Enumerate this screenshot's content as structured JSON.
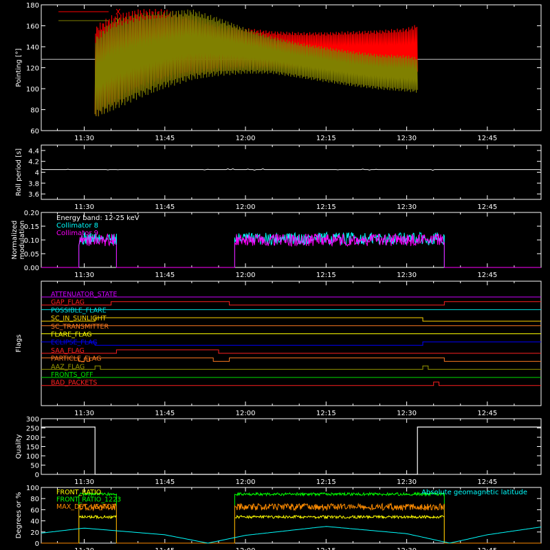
{
  "chart_data": [
    {
      "type": "line",
      "ylabel": "Pointing [°]",
      "ylim": [
        60,
        180
      ],
      "yticks": [
        60,
        80,
        100,
        120,
        140,
        160,
        180
      ],
      "xticks": [
        "11:30",
        "11:45",
        "12:00",
        "12:15",
        "12:30",
        "12:45"
      ],
      "xlim": [
        "11:22",
        "12:55"
      ],
      "legend": [
        "X",
        "Y"
      ],
      "reference_line": 128,
      "series": [
        {
          "name": "X",
          "color": "#ff0000",
          "x": [
            "11:32",
            "11:35",
            "11:40",
            "11:45",
            "11:50",
            "11:55",
            "12:00",
            "12:05",
            "12:10",
            "12:15",
            "12:20",
            "12:25",
            "12:30",
            "12:32"
          ],
          "upper": [
            160,
            170,
            176,
            176,
            170,
            162,
            158,
            155,
            154,
            154,
            155,
            156,
            158,
            162
          ],
          "lower": [
            72,
            80,
            96,
            106,
            112,
            116,
            118,
            118,
            118,
            118,
            118,
            117,
            115,
            112
          ]
        },
        {
          "name": "Y",
          "color": "#808000",
          "x": [
            "11:32",
            "11:35",
            "11:40",
            "11:45",
            "11:50",
            "11:55",
            "12:00",
            "12:05",
            "12:10",
            "12:15",
            "12:20",
            "12:25",
            "12:30",
            "12:32"
          ],
          "upper": [
            150,
            165,
            172,
            174,
            176,
            168,
            158,
            150,
            144,
            140,
            136,
            133,
            132,
            130
          ],
          "lower": [
            72,
            78,
            90,
            100,
            108,
            112,
            114,
            114,
            110,
            106,
            102,
            99,
            97,
            96
          ]
        }
      ]
    },
    {
      "type": "line",
      "ylabel": "Roll period [s]",
      "ylim": [
        3.5,
        4.5
      ],
      "yticks": [
        3.6,
        3.8,
        4.0,
        4.2,
        4.4
      ],
      "xticks": [
        "11:30",
        "11:45",
        "12:00",
        "12:15",
        "12:30",
        "12:45"
      ],
      "series": [
        {
          "name": "",
          "color": "#ffffff",
          "value": 4.05
        }
      ]
    },
    {
      "type": "line",
      "ylabel": "Normalized modulation",
      "ylim": [
        0,
        0.2
      ],
      "yticks": [
        "0.00",
        "0.05",
        "0.10",
        "0.15",
        "0.20"
      ],
      "xticks": [
        "11:30",
        "11:45",
        "12:00",
        "12:15",
        "12:30",
        "12:45"
      ],
      "legend": [
        "Energy band: 12-25 keV",
        "Collimator 8",
        "Collimator 9"
      ],
      "series": [
        {
          "name": "Collimator 8",
          "color": "#00ffff",
          "segments": [
            [
              "11:29",
              "11:36"
            ],
            [
              "11:58",
              "12:37"
            ]
          ],
          "mean": 0.105
        },
        {
          "name": "Collimator 9",
          "color": "#ff00ff",
          "segments": [
            [
              "11:29",
              "11:36"
            ],
            [
              "11:58",
              "12:37"
            ]
          ],
          "mean": 0.1
        }
      ]
    },
    {
      "type": "line",
      "ylabel": "Flags",
      "xticks": [
        "11:30",
        "11:45",
        "12:00",
        "12:15",
        "12:30",
        "12:45"
      ],
      "flags": [
        {
          "name": "ATTENUATOR_STATE",
          "color": "#cc00ff"
        },
        {
          "name": "GAP_FLAG",
          "color": "#ff2020"
        },
        {
          "name": "POSSIBLE_FLARE",
          "color": "#00e5e5"
        },
        {
          "name": "SC_IN_SUNLIGHT",
          "color": "#ffd700"
        },
        {
          "name": "SC_TRANSMITTER",
          "color": "#ff7a20"
        },
        {
          "name": "FLARE_FLAG",
          "color": "#ffff00"
        },
        {
          "name": "ECLIPSE_FLAG",
          "color": "#0000ff"
        },
        {
          "name": "SAA_FLAG",
          "color": "#ff2020"
        },
        {
          "name": "PARTICLE_FLAG",
          "color": "#ff7a20"
        },
        {
          "name": "AAZ_FLAG",
          "color": "#9a9a00"
        },
        {
          "name": "FRONTS_OFF",
          "color": "#00e000"
        },
        {
          "name": "BAD_PACKETS",
          "color": "#ff2020"
        }
      ]
    },
    {
      "type": "line",
      "ylabel": "Quality",
      "ylim": [
        0,
        300
      ],
      "yticks": [
        0,
        50,
        100,
        150,
        200,
        250,
        300
      ],
      "xticks": [
        "11:30",
        "11:45",
        "12:00",
        "12:15",
        "12:30",
        "12:45"
      ],
      "series": [
        {
          "name": "",
          "color": "#ffffff",
          "x": [
            "11:22",
            "11:32",
            "11:32",
            "12:32",
            "12:32",
            "12:55"
          ],
          "y": [
            255,
            255,
            0,
            0,
            255,
            255
          ]
        }
      ]
    },
    {
      "type": "line",
      "ylabel": "Degrees or %",
      "ylim": [
        0,
        100
      ],
      "yticks": [
        0,
        20,
        40,
        60,
        80,
        100
      ],
      "xticks": [
        "11:30",
        "11:45",
        "12:00",
        "12:15",
        "12:30",
        "12:45"
      ],
      "legend": [
        "FRONT_RATIO",
        "FRONT_RATIO_1223",
        "MAX_DET_VS_TOT",
        "Absolute geomagnetic latitude"
      ],
      "series": [
        {
          "name": "FRONT_RATIO",
          "color": "#ffff00",
          "mean": 47
        },
        {
          "name": "FRONT_RATIO_1223",
          "color": "#00ff00",
          "mean": 88
        },
        {
          "name": "MAX_DET_VS_TOT",
          "color": "#ff8c00",
          "mean": 65
        },
        {
          "name": "Absolute geomagnetic latitude",
          "color": "#00ffff",
          "x": [
            "11:22",
            "11:30",
            "11:45",
            "11:53",
            "12:00",
            "12:15",
            "12:30",
            "12:38",
            "12:45",
            "12:55"
          ],
          "y": [
            18,
            27,
            15,
            0,
            14,
            30,
            17,
            0,
            15,
            29
          ]
        }
      ]
    }
  ]
}
